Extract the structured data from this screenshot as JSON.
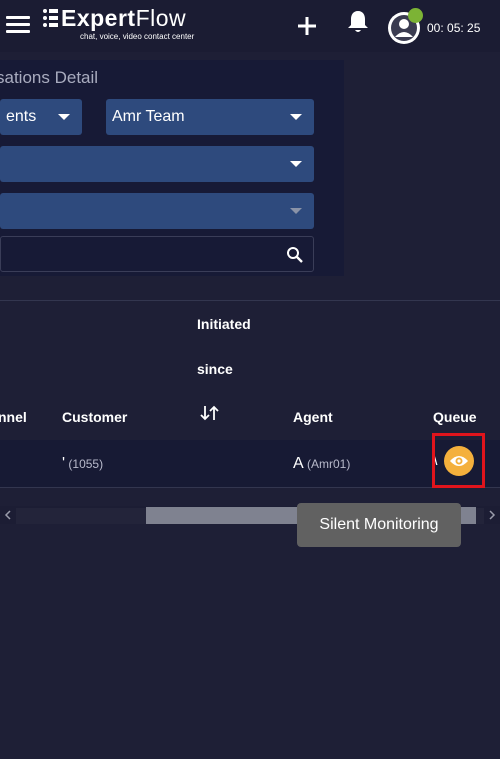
{
  "header": {
    "menu_icon": "hamburger-icon",
    "logo": {
      "main": "Expert",
      "accent": "Flow",
      "tagline": "chat, voice, video contact center"
    },
    "plus_icon": "plus-icon",
    "bell_icon": "bell-icon",
    "avatar_icon": "user-avatar-icon",
    "status_color": "#7cb335",
    "timer": "00: 05: 25"
  },
  "filters": {
    "title": "sations Detail",
    "select1": "ents",
    "select2": "Amr Team",
    "select3": "",
    "select4": "",
    "search_placeholder": ""
  },
  "table": {
    "headers": {
      "channel": "nnel",
      "customer": "Customer",
      "initiated_line1": "Initiated",
      "initiated_line2": "since",
      "agent": "Agent",
      "queue": "Queue"
    },
    "rows": [
      {
        "customer_main": "'",
        "customer_sub": "(1055)",
        "agent_main": "A",
        "agent_sub": "(Amr01)",
        "queue": "\\"
      }
    ]
  },
  "tooltip": "Silent Monitoring",
  "colors": {
    "accent": "#f4b03c",
    "highlight": "#e0141c",
    "select_bg": "#2e4a7d"
  }
}
